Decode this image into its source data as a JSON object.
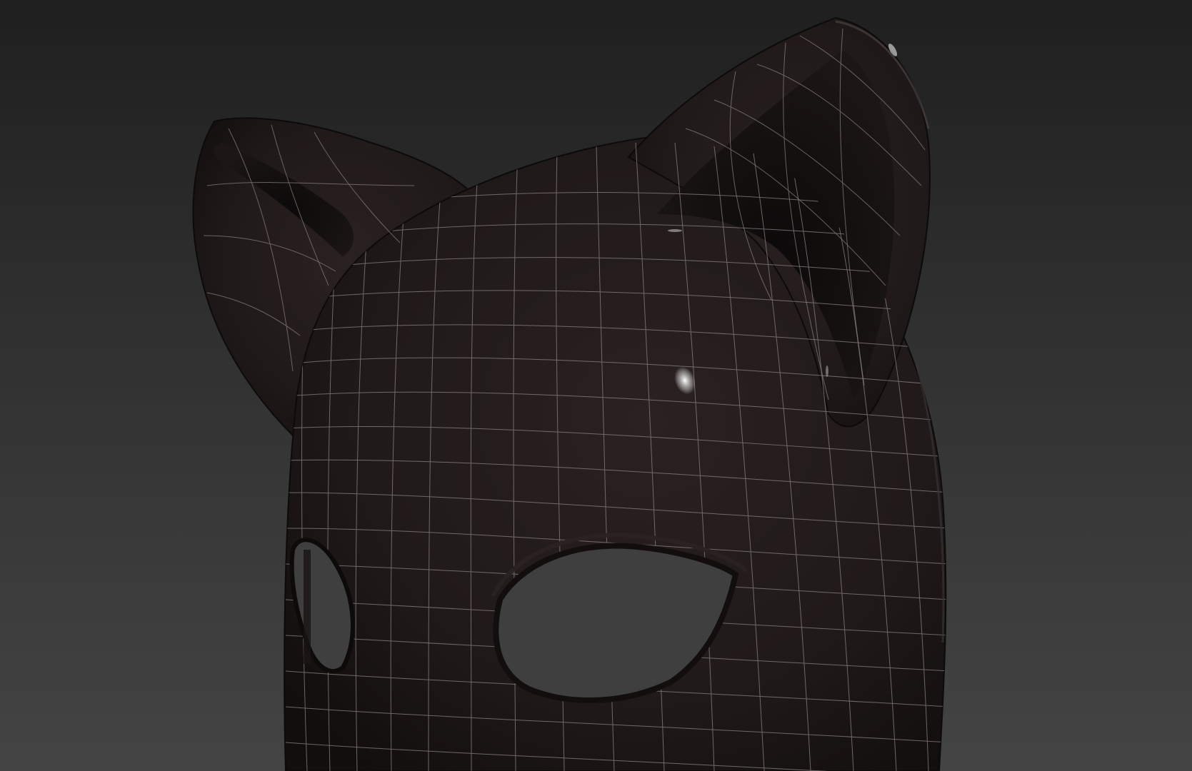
{
  "viewport": {
    "background_top": "#1f1f1f",
    "background_bottom": "#444444"
  },
  "model": {
    "object": "cat-ear-mask",
    "display_mode": "shaded-with-wireframe",
    "surface_color": "#231b1b",
    "wire_color": "#8c8484"
  }
}
